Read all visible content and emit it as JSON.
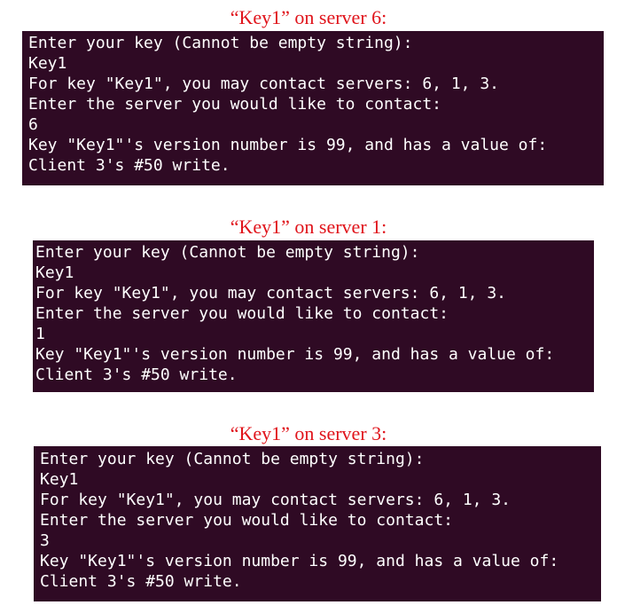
{
  "panels": [
    {
      "caption": "“Key1” on server 6:",
      "lines": [
        "Enter your key (Cannot be empty string):",
        "Key1",
        "For key \"Key1\", you may contact servers: 6, 1, 3.",
        "Enter the server you would like to contact:",
        "6",
        "Key \"Key1\"'s version number is 99, and has a value of:",
        "Client 3's #50 write."
      ]
    },
    {
      "caption": "“Key1” on server 1:",
      "lines": [
        "Enter your key (Cannot be empty string):",
        "Key1",
        "For key \"Key1\", you may contact servers: 6, 1, 3.",
        "Enter the server you would like to contact:",
        "1",
        "Key \"Key1\"'s version number is 99, and has a value of:",
        "Client 3's #50 write."
      ]
    },
    {
      "caption": "“Key1” on server 3:",
      "lines": [
        "Enter your key (Cannot be empty string):",
        "Key1",
        "For key \"Key1\", you may contact servers: 6, 1, 3.",
        "Enter the server you would like to contact:",
        "3",
        "Key \"Key1\"'s version number is 99, and has a value of:",
        "Client 3's #50 write."
      ]
    }
  ],
  "colors": {
    "caption_text": "#e0141b",
    "terminal_background": "#2f0a24",
    "terminal_text": "#ffffff"
  }
}
